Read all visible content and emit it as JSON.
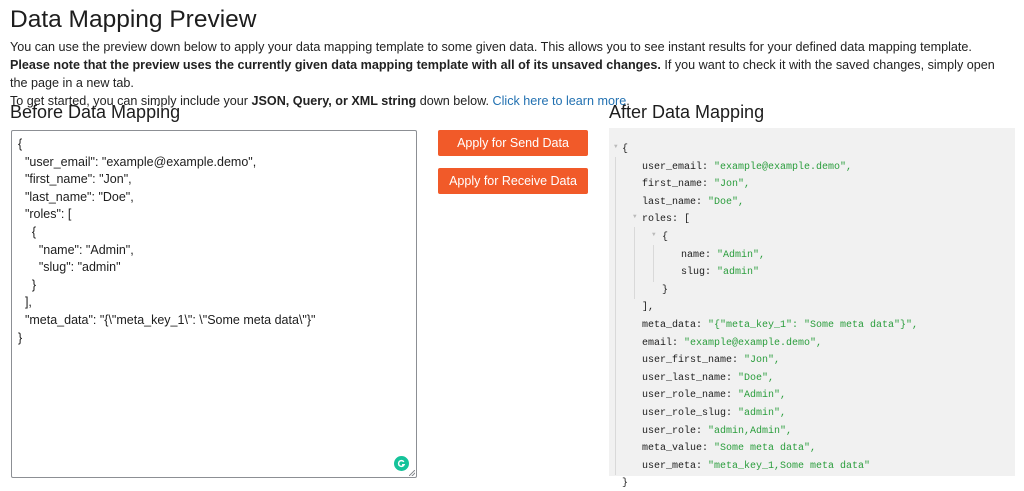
{
  "page": {
    "title": "Data Mapping Preview",
    "intro": {
      "p1": "You can use the preview down below to apply your data mapping template to some given data. This allows you to see instant results for your defined data mapping template. ",
      "p1_bold": "Please note that the preview uses the currently given data mapping template with all of its unsaved changes.",
      "p1_tail": " If you want to check it with the saved changes, simply open the page in a new tab.",
      "p2": "To get started, you can simply include your ",
      "p2_bold": "JSON, Query, or XML string",
      "p2_tail": " down below. ",
      "link": "Click here to learn more",
      "link_end": "."
    }
  },
  "before": {
    "title": "Before Data Mapping",
    "input_value": "{\n  \"user_email\": \"example@example.demo\",\n  \"first_name\": \"Jon\",\n  \"last_name\": \"Doe\",\n  \"roles\": [\n    {\n      \"name\": \"Admin\",\n      \"slug\": \"admin\"\n    }\n  ],\n  \"meta_data\": \"{\\\"meta_key_1\\\": \\\"Some meta data\\\"}\"\n}"
  },
  "actions": {
    "send_label": "Apply for Send Data",
    "receive_label": "Apply for Receive Data"
  },
  "after": {
    "title": "After Data Mapping",
    "open_brace": "{",
    "close_brace": "}",
    "roles_close": "],",
    "item_open": "{",
    "item_close": "}",
    "fields_top": [
      {
        "key": "user_email: ",
        "value": "\"example@example.demo\","
      },
      {
        "key": "first_name: ",
        "value": "\"Jon\","
      },
      {
        "key": "last_name: ",
        "value": "\"Doe\","
      }
    ],
    "roles_key": "roles: [",
    "role_fields": [
      {
        "key": "name: ",
        "value": "\"Admin\","
      },
      {
        "key": "slug: ",
        "value": "\"admin\""
      }
    ],
    "fields_bottom": [
      {
        "key": "meta_data: ",
        "value": "\"{\"meta_key_1\": \"Some meta data\"}\","
      },
      {
        "key": "email: ",
        "value": "\"example@example.demo\","
      },
      {
        "key": "user_first_name: ",
        "value": "\"Jon\","
      },
      {
        "key": "user_last_name: ",
        "value": "\"Doe\","
      },
      {
        "key": "user_role_name: ",
        "value": "\"Admin\","
      },
      {
        "key": "user_role_slug: ",
        "value": "\"admin\","
      },
      {
        "key": "user_role: ",
        "value": "\"admin,Admin\","
      },
      {
        "key": "meta_value: ",
        "value": "\"Some meta data\","
      },
      {
        "key": "user_meta: ",
        "value": "\"meta_key_1,Some meta data\""
      }
    ]
  },
  "colors": {
    "accent_button": "#f15a29",
    "link": "#2271b1",
    "string_value": "#2a9d3c",
    "output_background": "#f1f1f1",
    "grammar_badge": "#15c39a"
  },
  "icons": {
    "collapse": "triangle-down",
    "grammar": "grammarly-badge"
  }
}
